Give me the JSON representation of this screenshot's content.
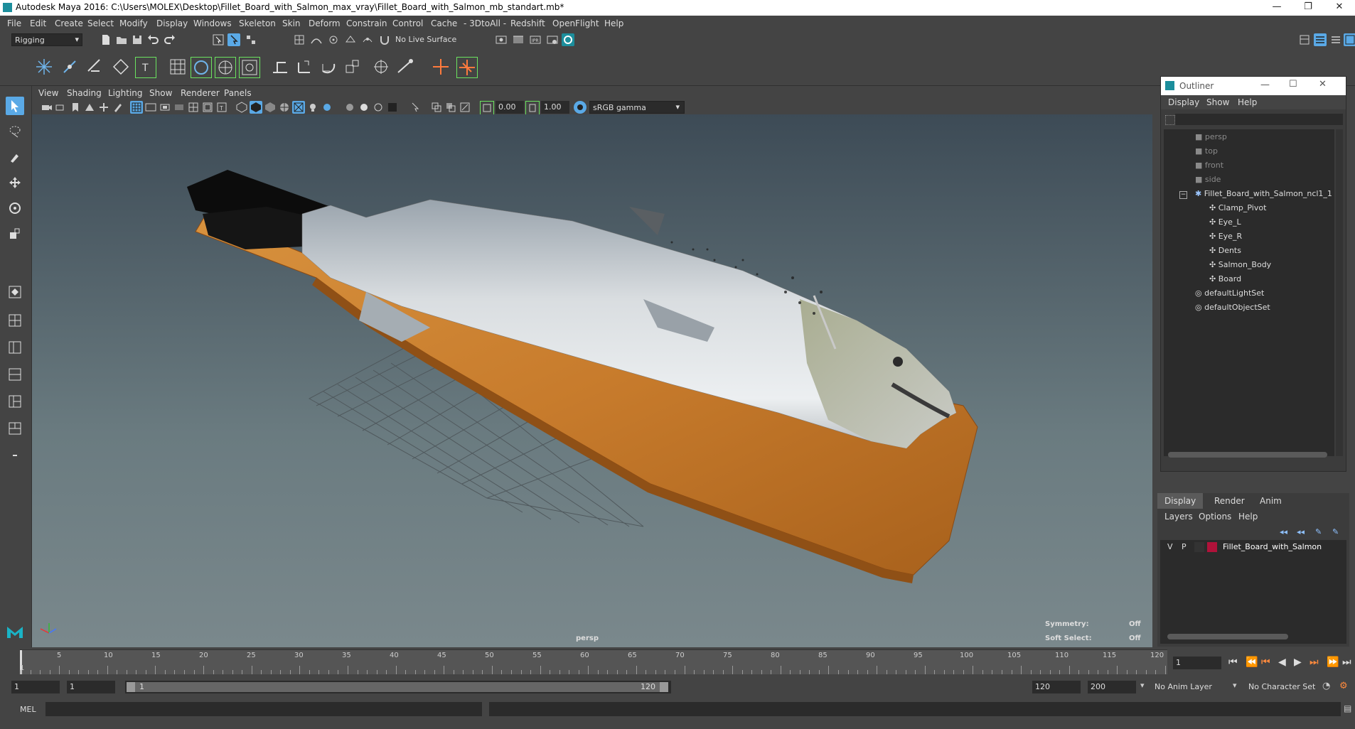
{
  "window": {
    "title": "Autodesk Maya 2016: C:\\Users\\MOLEX\\Desktop\\Fillet_Board_with_Salmon_max_vray\\Fillet_Board_with_Salmon_mb_standart.mb*",
    "minimize": "—",
    "restore": "❐",
    "close": "✕"
  },
  "menubar": [
    "File",
    "Edit",
    "Create",
    "Select",
    "Modify",
    "Display",
    "Windows",
    "Skeleton",
    "Skin",
    "Deform",
    "Constrain",
    "Control",
    "Cache",
    "- 3DtoAll -",
    "Redshift",
    "OpenFlight",
    "Help"
  ],
  "statusline": {
    "menuset": "Rigging",
    "live_surface": "No Live Surface"
  },
  "viewport": {
    "menu": [
      "View",
      "Shading",
      "Lighting",
      "Show",
      "Renderer",
      "Panels"
    ],
    "exposure": "0.00",
    "gamma": "1.00",
    "color_space": "sRGB gamma",
    "camera_label": "persp",
    "symmetry_label": "Symmetry:",
    "symmetry_value": "Off",
    "soft_select_label": "Soft Select:",
    "soft_select_value": "Off"
  },
  "outliner": {
    "title": "Outliner",
    "menu": [
      "Display",
      "Show",
      "Help"
    ],
    "cameras": [
      "persp",
      "top",
      "front",
      "side"
    ],
    "group": "Fillet_Board_with_Salmon_ncl1_1",
    "children": [
      "Clamp_Pivot",
      "Eye_L",
      "Eye_R",
      "Dents",
      "Salmon_Body",
      "Board"
    ],
    "sets": [
      "defaultLightSet",
      "defaultObjectSet"
    ]
  },
  "layer_editor": {
    "tabs": [
      "Display",
      "Render",
      "Anim"
    ],
    "menu": [
      "Layers",
      "Options",
      "Help"
    ],
    "layer": {
      "v": "V",
      "p": "P",
      "name": "Fillet_Board_with_Salmon",
      "color": "#b0123a"
    }
  },
  "timeline": {
    "ticks": [
      "1",
      "5",
      "10",
      "15",
      "20",
      "25",
      "30",
      "35",
      "40",
      "45",
      "50",
      "55",
      "60",
      "65",
      "70",
      "75",
      "80",
      "85",
      "90",
      "95",
      "100",
      "105",
      "110",
      "115",
      "120"
    ],
    "current_frame": "1"
  },
  "range": {
    "start": "1",
    "playback_start": "1",
    "slider_start": "1",
    "slider_end": "120",
    "playback_end": "120",
    "end": "200",
    "anim_layer": "No Anim Layer",
    "char_set": "No Character Set"
  },
  "command": {
    "label": "MEL"
  },
  "accent_color": "#5aa9e6"
}
